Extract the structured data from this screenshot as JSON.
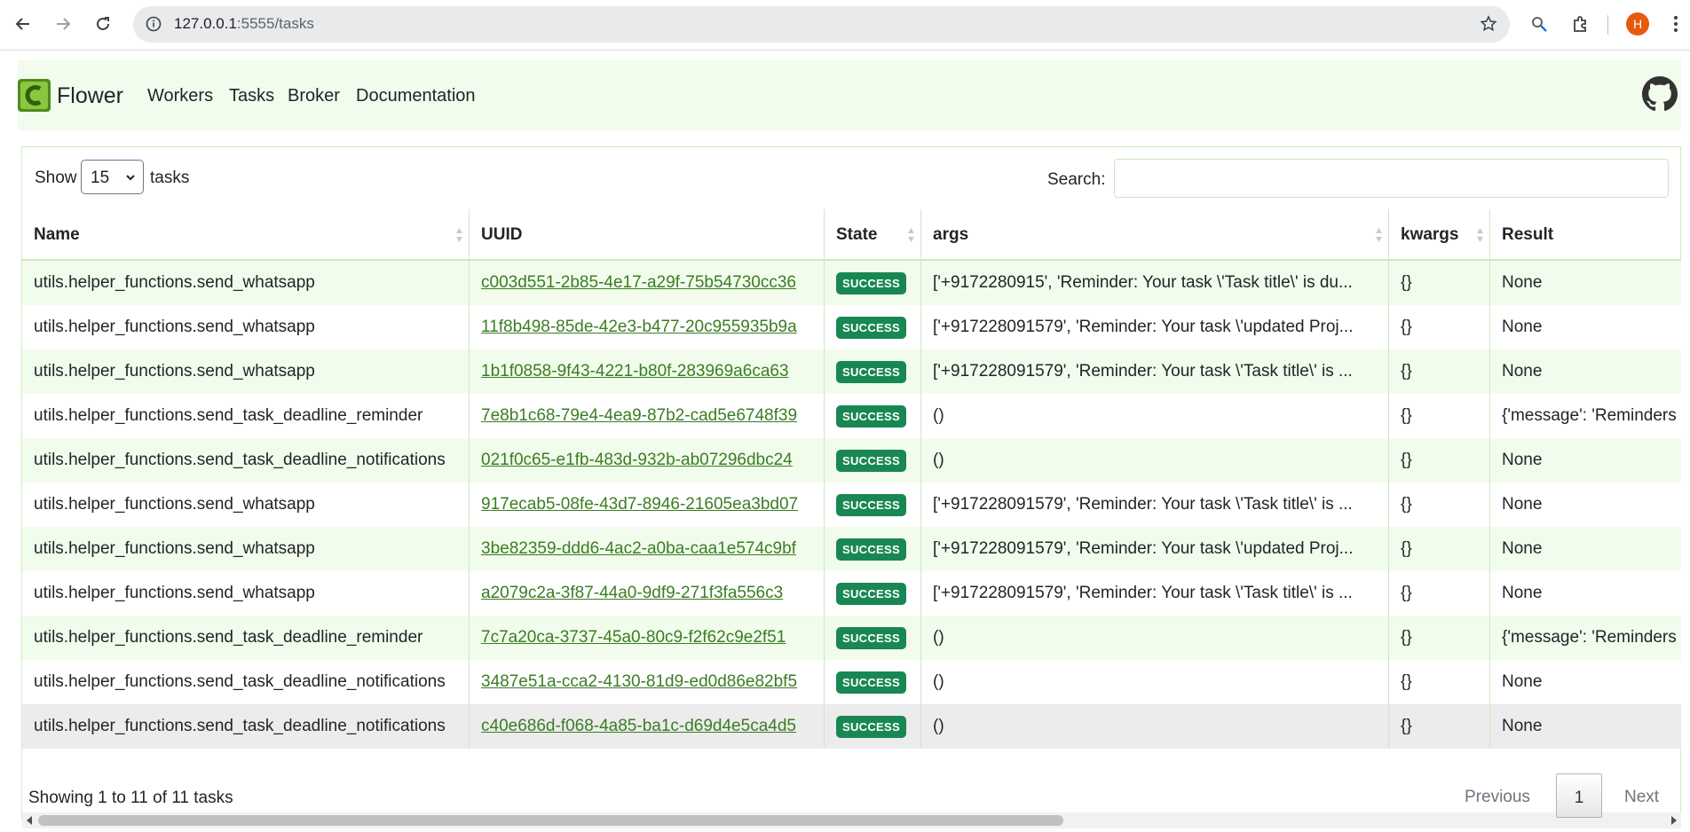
{
  "browser": {
    "url_host": "127.0.0.1",
    "url_path": ":5555/tasks",
    "avatar_letter": "H"
  },
  "navbar": {
    "brand": "Flower",
    "links": [
      "Workers",
      "Tasks",
      "Broker",
      "Documentation"
    ]
  },
  "controls": {
    "show_label": "Show",
    "page_length": "15",
    "tasks_label": "tasks",
    "search_label": "Search:",
    "search_value": ""
  },
  "table": {
    "columns": [
      "Name",
      "UUID",
      "State",
      "args",
      "kwargs",
      "Result"
    ],
    "rows": [
      {
        "name": "utils.helper_functions.send_whatsapp",
        "uuid": "c003d551-2b85-4e17-a29f-75b54730cc36",
        "state": "SUCCESS",
        "args": "['+9172280915', 'Reminder: Your task \\'Task title\\' is du...",
        "kwargs": "{}",
        "result": "None"
      },
      {
        "name": "utils.helper_functions.send_whatsapp",
        "uuid": "11f8b498-85de-42e3-b477-20c955935b9a",
        "state": "SUCCESS",
        "args": "['+917228091579', 'Reminder: Your task \\'updated Proj...",
        "kwargs": "{}",
        "result": "None"
      },
      {
        "name": "utils.helper_functions.send_whatsapp",
        "uuid": "1b1f0858-9f43-4221-b80f-283969a6ca63",
        "state": "SUCCESS",
        "args": "['+917228091579', 'Reminder: Your task \\'Task title\\' is ...",
        "kwargs": "{}",
        "result": "None"
      },
      {
        "name": "utils.helper_functions.send_task_deadline_reminder",
        "uuid": "7e8b1c68-79e4-4ea9-87b2-cad5e6748f39",
        "state": "SUCCESS",
        "args": "()",
        "kwargs": "{}",
        "result": "{'message': 'Reminders"
      },
      {
        "name": "utils.helper_functions.send_task_deadline_notifications",
        "uuid": "021f0c65-e1fb-483d-932b-ab07296dbc24",
        "state": "SUCCESS",
        "args": "()",
        "kwargs": "{}",
        "result": "None"
      },
      {
        "name": "utils.helper_functions.send_whatsapp",
        "uuid": "917ecab5-08fe-43d7-8946-21605ea3bd07",
        "state": "SUCCESS",
        "args": "['+917228091579', 'Reminder: Your task \\'Task title\\' is ...",
        "kwargs": "{}",
        "result": "None"
      },
      {
        "name": "utils.helper_functions.send_whatsapp",
        "uuid": "3be82359-ddd6-4ac2-a0ba-caa1e574c9bf",
        "state": "SUCCESS",
        "args": "['+917228091579', 'Reminder: Your task \\'updated Proj...",
        "kwargs": "{}",
        "result": "None"
      },
      {
        "name": "utils.helper_functions.send_whatsapp",
        "uuid": "a2079c2a-3f87-44a0-9df9-271f3fa556c3",
        "state": "SUCCESS",
        "args": "['+917228091579', 'Reminder: Your task \\'Task title\\' is ...",
        "kwargs": "{}",
        "result": "None"
      },
      {
        "name": "utils.helper_functions.send_task_deadline_reminder",
        "uuid": "7c7a20ca-3737-45a0-80c9-f2f62c9e2f51",
        "state": "SUCCESS",
        "args": "()",
        "kwargs": "{}",
        "result": "{'message': 'Reminders"
      },
      {
        "name": "utils.helper_functions.send_task_deadline_notifications",
        "uuid": "3487e51a-cca2-4130-81d9-ed0d86e82bf5",
        "state": "SUCCESS",
        "args": "()",
        "kwargs": "{}",
        "result": "None"
      },
      {
        "name": "utils.helper_functions.send_task_deadline_notifications",
        "uuid": "c40e686d-f068-4a85-ba1c-d69d4e5ca4d5",
        "state": "SUCCESS",
        "args": "()",
        "kwargs": "{}",
        "result": "None"
      }
    ]
  },
  "footer": {
    "info": "Showing 1 to 11 of 11 tasks",
    "previous": "Previous",
    "current_page": "1",
    "next": "Next"
  },
  "colors": {
    "navbar_bg": "#f1fcec",
    "row_odd": "#f1fcec",
    "link": "#3b7d23",
    "success_badge": "#198754"
  },
  "icons": [
    "back-icon",
    "forward-icon",
    "reload-icon",
    "site-info-icon",
    "bookmark-star-icon",
    "lens-icon",
    "extensions-icon",
    "menu-icon",
    "flower-logo-icon",
    "github-icon",
    "sort-icon"
  ]
}
